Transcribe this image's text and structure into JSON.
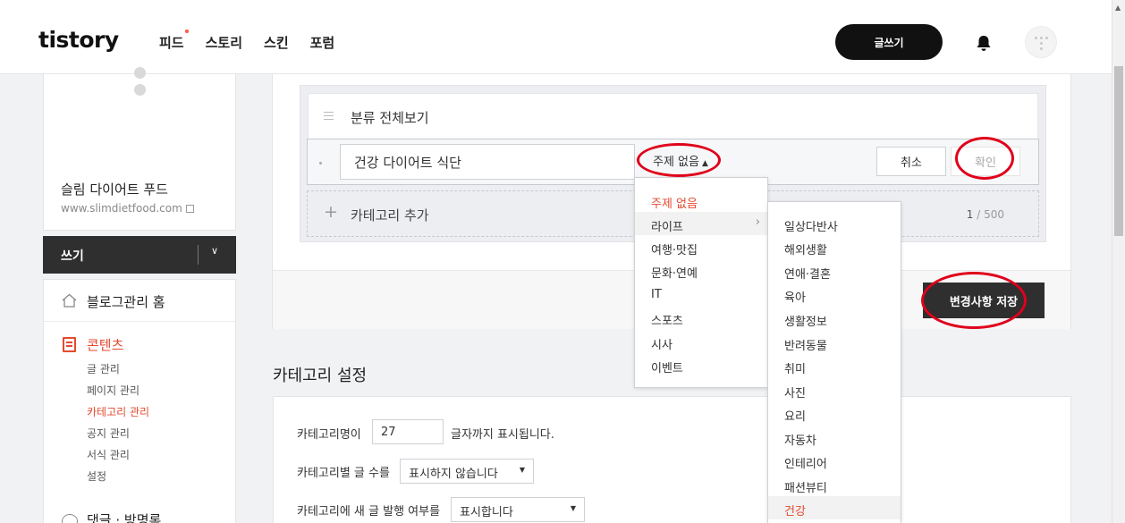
{
  "header": {
    "logo": "tistory",
    "nav": [
      "피드",
      "스토리",
      "스킨",
      "포럼"
    ],
    "write_button": "글쓰기"
  },
  "sidebar": {
    "blog_name": "슬림 다이어트 푸드",
    "blog_url": "www.slimdietfood.com",
    "write_label": "쓰기",
    "home_label": "블로그관리 홈",
    "contents_label": "콘텐츠",
    "sub_items": [
      "글 관리",
      "페이지 관리",
      "카테고리 관리",
      "공지 관리",
      "서식 관리",
      "설정"
    ],
    "active_sub_item": "카테고리 관리",
    "comments_label": "댓글 · 방명록"
  },
  "category_list": {
    "all_label": "분류 전체보기",
    "edit_name": "건강 다이어트 식단",
    "topic_select": "주제 없음",
    "cancel": "취소",
    "confirm": "확인",
    "add_label": "카테고리 추가",
    "count_current": "1",
    "count_max": "/ 500",
    "save_button": "변경사항 저장"
  },
  "settings": {
    "title": "카테고리 설정",
    "name_label": "카테고리명이",
    "name_value": "27",
    "name_suffix": "글자까지 표시됩니다.",
    "count_label": "카테고리별 글 수를",
    "count_value": "표시하지 않습니다",
    "new_label": "카테고리에 새 글 발행 여부를",
    "new_value": "표시합니다"
  },
  "topic_menu": {
    "items": [
      "주제 없음",
      "라이프",
      "여행·맛집",
      "문화·연예",
      "IT",
      "스포츠",
      "시사",
      "이벤트"
    ],
    "sub_items": [
      "일상다반사",
      "해외생활",
      "연애·결혼",
      "육아",
      "생활정보",
      "반려동물",
      "취미",
      "사진",
      "요리",
      "자동차",
      "인테리어",
      "패션뷰티",
      "건강"
    ]
  },
  "colors": {
    "accent": "#e54a30",
    "annotation": "#e0001b",
    "dark_button": "#2f2f2f"
  }
}
